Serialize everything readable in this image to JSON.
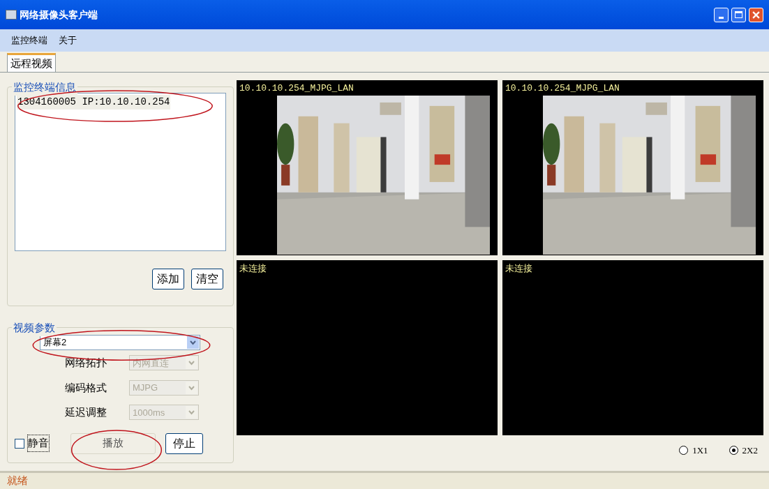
{
  "window": {
    "title": "网络摄像头客户端"
  },
  "menu": [
    "监控终端",
    "关于"
  ],
  "tabs": [
    {
      "label": "远程视频",
      "selected": true
    }
  ],
  "terminal_info": {
    "title": "监控终端信息",
    "items": [
      {
        "label": "1304160005 IP:10.10.10.254",
        "selected": false
      }
    ],
    "buttons": [
      "添加",
      "清空"
    ]
  },
  "video_params": {
    "title": "视频参数",
    "screen_select": {
      "value": "屏幕2"
    },
    "fields": [
      {
        "label": "网络拓扑",
        "value": "内网直连",
        "disabled": true
      },
      {
        "label": "编码格式",
        "value": "MJPG",
        "disabled": true
      },
      {
        "label": "延迟调整",
        "value": "1000ms",
        "disabled": true
      }
    ],
    "mute": {
      "label": "静音",
      "checked": false
    },
    "play_button": {
      "label": "播放"
    },
    "stop_button": {
      "label": "停止"
    }
  },
  "video_cells": [
    {
      "kind": "stream",
      "label": "10.10.10.254_MJPG_LAN"
    },
    {
      "kind": "stream",
      "label": "10.10.10.254_MJPG_LAN"
    },
    {
      "kind": "empty",
      "label": "未连接"
    },
    {
      "kind": "empty",
      "label": "未连接"
    }
  ],
  "layouts": [
    {
      "label": "1X1",
      "selected": false
    },
    {
      "label": "2X2",
      "selected": true
    }
  ],
  "status_bar": {
    "text": "就绪"
  }
}
